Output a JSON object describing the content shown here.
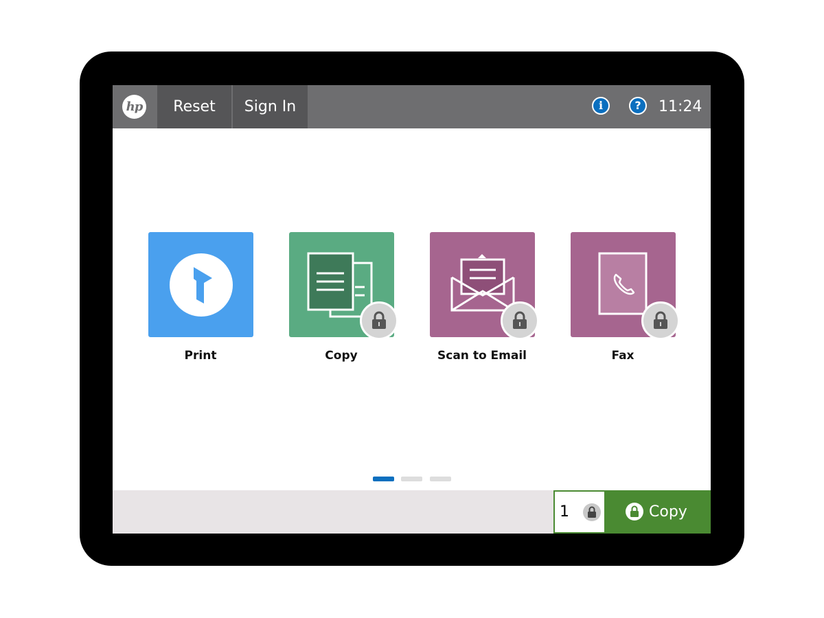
{
  "header": {
    "logo_text": "hp",
    "reset_label": "Reset",
    "signin_label": "Sign In",
    "info_glyph": "i",
    "help_glyph": "?",
    "time": "11:24"
  },
  "apps": [
    {
      "label": "Print",
      "icon": "print-app-icon",
      "color": "#4aa0ee",
      "locked": false
    },
    {
      "label": "Copy",
      "icon": "copy-documents-icon",
      "color": "#5aab82",
      "locked": true
    },
    {
      "label": "Scan to Email",
      "icon": "envelope-icon",
      "color": "#a6658f",
      "locked": true
    },
    {
      "label": "Fax",
      "icon": "fax-phone-icon",
      "color": "#a6658f",
      "locked": true
    }
  ],
  "pager": {
    "pages": 3,
    "current": 1
  },
  "footer": {
    "quantity": "1",
    "copy_label": "Copy",
    "accent": "#4a8a32"
  }
}
